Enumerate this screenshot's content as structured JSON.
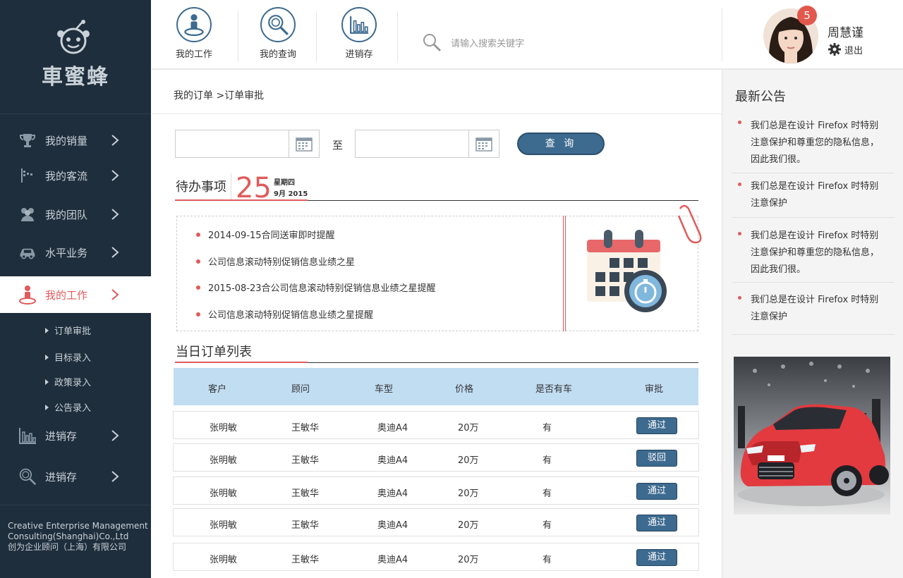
{
  "brand": {
    "name": "車蜜蜂"
  },
  "sidebar": {
    "items": [
      {
        "label": "我的销量",
        "icon": "trophy-icon"
      },
      {
        "label": "我的客流",
        "icon": "flag-icon"
      },
      {
        "label": "我的团队",
        "icon": "team-icon"
      },
      {
        "label": "水平业务",
        "icon": "car-icon"
      },
      {
        "label": "我的工作",
        "icon": "worker-icon",
        "active": true
      },
      {
        "label": "进销存",
        "icon": "bar-chart-icon"
      },
      {
        "label": "进销存",
        "icon": "magnify-icon"
      }
    ],
    "subitems": [
      "订单审批",
      "目标录入",
      "政策录入",
      "公告录入"
    ],
    "footer": {
      "line1": "Creative Enterprise Management",
      "line2": "Consulting(Shanghai)Co.,Ltd",
      "line3": "创为企业顾问（上海）有限公司"
    }
  },
  "topbar": {
    "buttons": [
      "我的工作",
      "我的查询",
      "进销存"
    ],
    "search_placeholder": "请输入搜索关键字",
    "user": {
      "name": "周慧谨",
      "badge": "5",
      "logout": "退出"
    }
  },
  "breadcrumb": "我的订单 >订单审批",
  "filter": {
    "to_label": "至",
    "query_label": "查 询"
  },
  "todo": {
    "title": "待办事项",
    "day": "25",
    "weekday": "星期四",
    "month": "9月 2015",
    "items": [
      "2014-09-15合同送审即时提醒",
      "公司信息滚动特别促销信息业绩之星",
      "2015-08-23合公司信息滚动特别促销信息业绩之星提醒",
      "公司信息滚动特别促销信息业绩之星提醒"
    ]
  },
  "orders": {
    "title": "当日订单列表",
    "columns": [
      "客户",
      "顾问",
      "车型",
      "价格",
      "是否有车",
      "审批"
    ],
    "rows": [
      {
        "customer": "张明敏",
        "advisor": "王敏华",
        "model": "奥迪A4",
        "price": "20万",
        "has_car": "有",
        "action": "通过"
      },
      {
        "customer": "张明敏",
        "advisor": "王敏华",
        "model": "奥迪A4",
        "price": "20万",
        "has_car": "有",
        "action": "驳回"
      },
      {
        "customer": "张明敏",
        "advisor": "王敏华",
        "model": "奥迪A4",
        "price": "20万",
        "has_car": "有",
        "action": "通过"
      },
      {
        "customer": "张明敏",
        "advisor": "王敏华",
        "model": "奥迪A4",
        "price": "20万",
        "has_car": "有",
        "action": "通过"
      },
      {
        "customer": "张明敏",
        "advisor": "王敏华",
        "model": "奥迪A4",
        "price": "20万",
        "has_car": "有",
        "action": "通过"
      }
    ]
  },
  "notices": {
    "title": "最新公告",
    "items": [
      "我们总是在设计 Firefox 时特别注意保护和尊重您的隐私信息，因此我们很。",
      "我们总是在设计 Firefox 时特别注意保护",
      "我们总是在设计 Firefox 时特别注意保护和尊重您的隐私信息，因此我们很。",
      "我们总是在设计 Firefox 时特别注意保护"
    ]
  },
  "colors": {
    "sidebar_bg": "#1f2e3c",
    "accent_red": "#e05b5b",
    "primary_blue": "#3d6a8f",
    "table_head": "#c1ddf2"
  }
}
